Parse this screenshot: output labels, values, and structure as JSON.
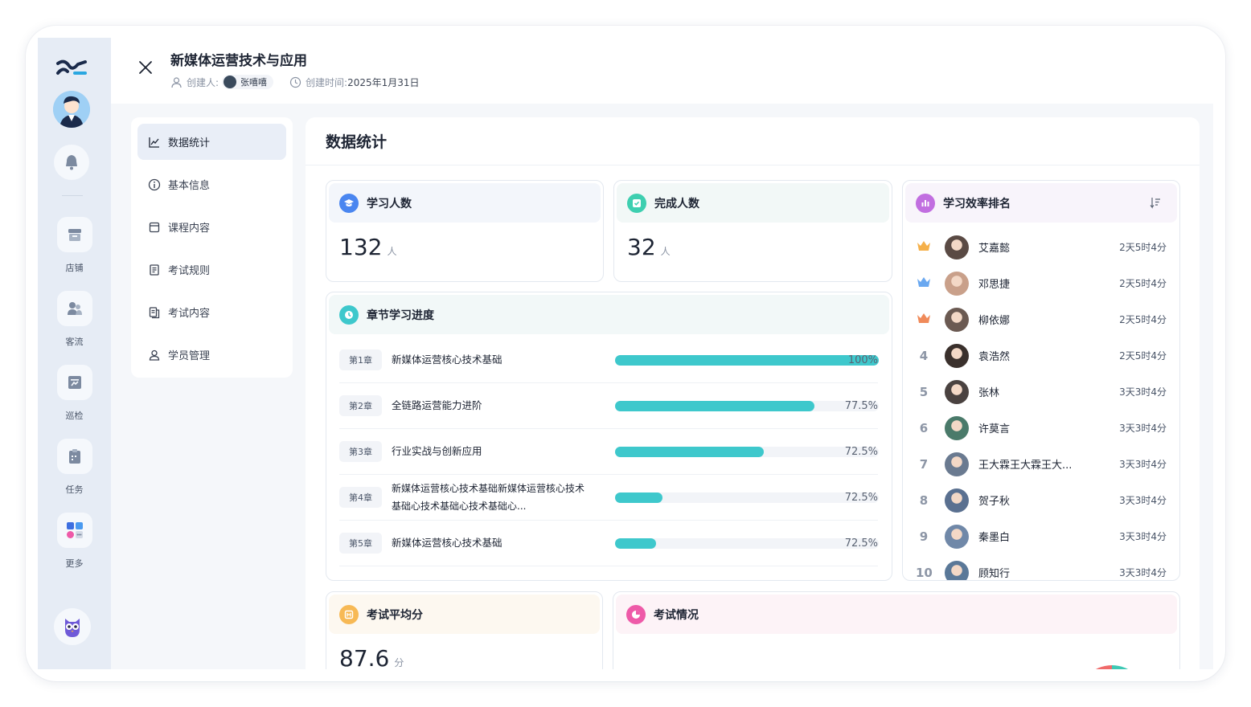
{
  "header": {
    "title": "新媒体运营技术与应用",
    "creator_label": "创建人:",
    "creator_name": "张嘻嘻",
    "created_label": "创建时间:",
    "created_value": "2025年1月31日"
  },
  "rail": {
    "items": [
      {
        "label": "店铺",
        "icon": "store-icon"
      },
      {
        "label": "客流",
        "icon": "customers-icon"
      },
      {
        "label": "巡检",
        "icon": "inspection-icon"
      },
      {
        "label": "任务",
        "icon": "task-icon"
      },
      {
        "label": "更多",
        "icon": "more-apps-icon"
      }
    ]
  },
  "subnav": {
    "items": [
      {
        "label": "数据统计",
        "icon": "chart-icon",
        "active": true
      },
      {
        "label": "基本信息",
        "icon": "info-icon"
      },
      {
        "label": "课程内容",
        "icon": "course-icon"
      },
      {
        "label": "考试规则",
        "icon": "rules-icon"
      },
      {
        "label": "考试内容",
        "icon": "exam-content-icon"
      },
      {
        "label": "学员管理",
        "icon": "user-icon"
      }
    ]
  },
  "main": {
    "title": "数据统计",
    "learners": {
      "label": "学习人数",
      "value": "132",
      "unit": "人"
    },
    "completed": {
      "label": "完成人数",
      "value": "32",
      "unit": "人"
    },
    "chapters": {
      "label": "章节学习进度",
      "rows": [
        {
          "tag": "第1章",
          "name": "新媒体运营核心技术基础",
          "percent": "100%",
          "fill": 100
        },
        {
          "tag": "第2章",
          "name": "全链路运营能力进阶",
          "percent": "77.5%",
          "fill": 75.5
        },
        {
          "tag": "第3章",
          "name": "行业实战与创新应用",
          "percent": "72.5%",
          "fill": 56.5
        },
        {
          "tag": "第4章",
          "name": "新媒体运营核心技术基础新媒体运营核心技术基础心技术基础心技术基础心...",
          "percent": "72.5%",
          "fill": 18
        },
        {
          "tag": "第5章",
          "name": "新媒体运营核心技术基础",
          "percent": "72.5%",
          "fill": 15.5
        }
      ]
    },
    "ranking": {
      "label": "学习效率排名",
      "rows": [
        {
          "rank": "",
          "name": "艾嘉懿",
          "time": "2天5时4分",
          "medal": "#f5b04a"
        },
        {
          "rank": "",
          "name": "邓思捷",
          "time": "2天5时4分",
          "medal": "#6aa8f0"
        },
        {
          "rank": "",
          "name": "柳依娜",
          "time": "2天5时4分",
          "medal": "#f08a5a"
        },
        {
          "rank": "4",
          "name": "袁浩然",
          "time": "2天5时4分"
        },
        {
          "rank": "5",
          "name": "张林",
          "time": "3天3时4分"
        },
        {
          "rank": "6",
          "name": "许莫言",
          "time": "3天3时4分"
        },
        {
          "rank": "7",
          "name": "王大霖王大霖王大...",
          "time": "3天3时4分"
        },
        {
          "rank": "8",
          "name": "贺子秋",
          "time": "3天3时4分"
        },
        {
          "rank": "9",
          "name": "秦墨白",
          "time": "3天3时4分"
        },
        {
          "rank": "10",
          "name": "顾知行",
          "time": "3天3时4分"
        }
      ]
    },
    "exam_avg": {
      "label": "考试平均分",
      "value": "87.6",
      "unit": "分"
    },
    "exam_status": {
      "label": "考试情况"
    }
  },
  "colors": {
    "accent_teal": "#3ec8cc",
    "learners_badge": "#4a86f0",
    "completed_badge": "#3ecfb0",
    "chapter_badge": "#3ec8cc",
    "ranking_badge": "#c16ee0",
    "exam_avg_badge": "#f7b955",
    "exam_status_badge": "#ee5aa8"
  }
}
